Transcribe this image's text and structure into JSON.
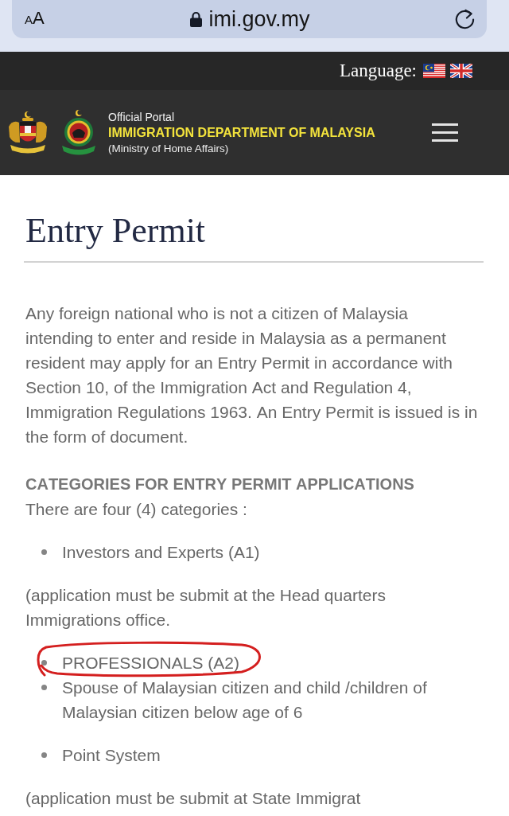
{
  "browser_bar": {
    "text_size_button": "AA",
    "url": "imi.gov.my"
  },
  "top_bar": {
    "language_label": "Language:"
  },
  "header": {
    "eyebrow": "Official Portal",
    "title": "IMMIGRATION DEPARTMENT OF MALAYSIA",
    "subtitle": "(Ministry of Home Affairs)"
  },
  "article": {
    "title": "Entry Permit",
    "intro": "Any foreign national who is not a citizen of Malaysia intending to enter and reside in Malaysia as a permanent resident may apply for an Entry Permit in accordance with Section 10, of the Immigration Act and Regulation 4, Immigration Regulations 1963. An Entry Permit is issued is in the form of document.",
    "section_heading": "CATEGORIES FOR ENTRY PERMIT APPLICATIONS",
    "section_lead": "There are four (4) categories :",
    "blocks": [
      {
        "kind": "bullet_list",
        "items": [
          {
            "text": "Investors and Experts (A1)",
            "circled": false
          }
        ]
      },
      {
        "kind": "note",
        "text": "(application must be submit at the Head quarters Immigrations office."
      },
      {
        "kind": "bullet_list",
        "items": [
          {
            "text": "PROFESSIONALS (A2)",
            "circled": true
          },
          {
            "text": "Spouse of Malaysian citizen and child /children of Malaysian citizen below age of 6",
            "circled": false
          }
        ]
      },
      {
        "kind": "bullet_list",
        "items": [
          {
            "text": "Point System",
            "circled": false
          }
        ]
      },
      {
        "kind": "note",
        "text": "(application must be submit at State Immigrat"
      }
    ]
  }
}
